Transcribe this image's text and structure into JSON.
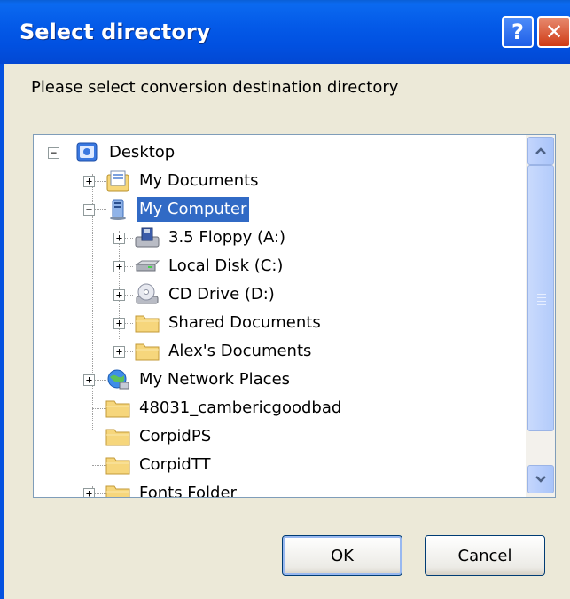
{
  "window": {
    "title": "Select directory",
    "help_label": "?",
    "close_label": "✕"
  },
  "prompt": "Please select conversion destination directory",
  "tree": {
    "items": [
      {
        "label": "Desktop",
        "icon": "desktop-icon",
        "expander": "−"
      },
      {
        "label": "My Documents",
        "icon": "my-documents-icon",
        "expander": "+"
      },
      {
        "label": "My Computer",
        "icon": "my-computer-icon",
        "expander": "−",
        "selected": true
      },
      {
        "label": "3.5 Floppy (A:)",
        "icon": "floppy-drive-icon",
        "expander": "+"
      },
      {
        "label": "Local Disk (C:)",
        "icon": "hard-disk-icon",
        "expander": "+"
      },
      {
        "label": "CD Drive (D:)",
        "icon": "cd-drive-icon",
        "expander": "+"
      },
      {
        "label": "Shared Documents",
        "icon": "folder-icon",
        "expander": "+"
      },
      {
        "label": "Alex's Documents",
        "icon": "folder-icon",
        "expander": "+"
      },
      {
        "label": "My Network Places",
        "icon": "network-places-icon",
        "expander": "+"
      },
      {
        "label": "48031_cambericgoodbad",
        "icon": "folder-icon",
        "expander": ""
      },
      {
        "label": "CorpidPS",
        "icon": "folder-icon",
        "expander": ""
      },
      {
        "label": "CorpidTT",
        "icon": "folder-icon",
        "expander": ""
      },
      {
        "label": "Fonts Folder",
        "icon": "folder-icon",
        "expander": "+"
      }
    ],
    "scroll": {
      "up_icon": "scroll-up-icon",
      "down_icon": "scroll-down-icon"
    }
  },
  "buttons": {
    "ok": "OK",
    "cancel": "Cancel"
  },
  "colors": {
    "titlebar": "#0451e0",
    "selection": "#316ac5",
    "dialog_bg": "#ece9d8"
  }
}
